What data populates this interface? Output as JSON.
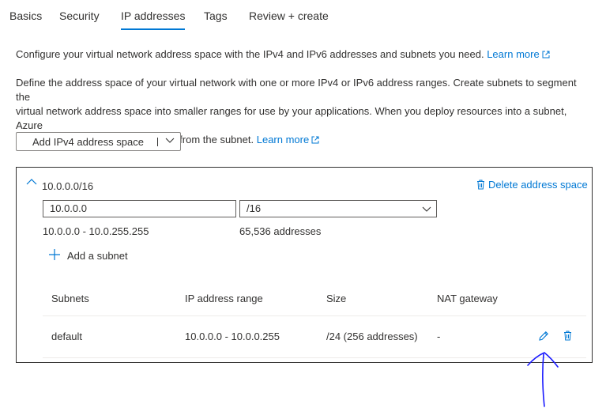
{
  "tabs": [
    {
      "label": "Basics",
      "active": false
    },
    {
      "label": "Security",
      "active": false
    },
    {
      "label": "IP addresses",
      "active": true
    },
    {
      "label": "Tags",
      "active": false
    },
    {
      "label": "Review + create",
      "active": false
    }
  ],
  "intro": {
    "text": "Configure your virtual network address space with the IPv4 and IPv6 addresses and subnets you need.",
    "link": "Learn more"
  },
  "description": {
    "line1": "Define the address space of your virtual network with one or more IPv4 or IPv6 address ranges. Create subnets to segment the",
    "line2": "virtual network address space into smaller ranges for use by your applications. When you deploy resources into a subnet, Azure",
    "line3": "assigns the resource an IP address from the subnet.",
    "link": "Learn more"
  },
  "add_button": {
    "label": "Add IPv4 address space"
  },
  "address_space": {
    "title": "10.0.0.0/16",
    "delete_label": "Delete address space",
    "ip_input_value": "10.0.0.0",
    "prefix_value": "/16",
    "range_text": "10.0.0.0 - 10.0.255.255",
    "count_text": "65,536 addresses",
    "add_subnet_label": "Add a subnet"
  },
  "subnets_table": {
    "headers": [
      "Subnets",
      "IP address range",
      "Size",
      "NAT gateway"
    ],
    "rows": [
      {
        "name": "default",
        "range": "10.0.0.0 - 10.0.0.255",
        "size": "/24 (256 addresses)",
        "nat": "-"
      }
    ]
  },
  "colors": {
    "accent": "#0078d4",
    "text": "#323130",
    "annotation": "#1a1aff"
  }
}
